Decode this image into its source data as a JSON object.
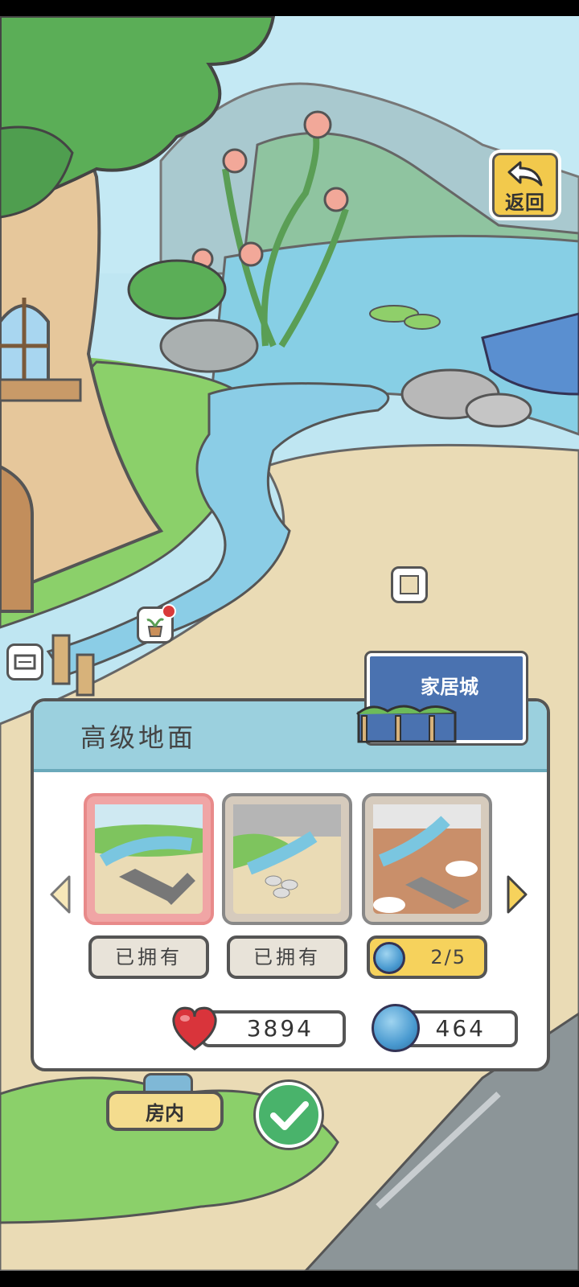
{
  "header": {
    "back_label": "返回"
  },
  "panel": {
    "title": "高级地面",
    "shop_label": "家居城",
    "items": [
      {
        "status": "已拥有",
        "selected": true
      },
      {
        "status": "已拥有",
        "selected": false
      },
      {
        "price": "2/5",
        "selected": false
      }
    ]
  },
  "currency": {
    "hearts": "3894",
    "coins": "464"
  },
  "bottom": {
    "room_label": "房内"
  },
  "colors": {
    "panel_header": "#9bd0de",
    "shop_board": "#4a72b0",
    "price_bg": "#f6d25c",
    "confirm": "#49b36b"
  },
  "icons": [
    "back-arrow-icon",
    "plant-pot-icon",
    "frame-icon",
    "mailbox-icon",
    "left-arrow-icon",
    "right-arrow-icon",
    "clover-coin-icon",
    "heart-icon",
    "checkmark-icon"
  ]
}
